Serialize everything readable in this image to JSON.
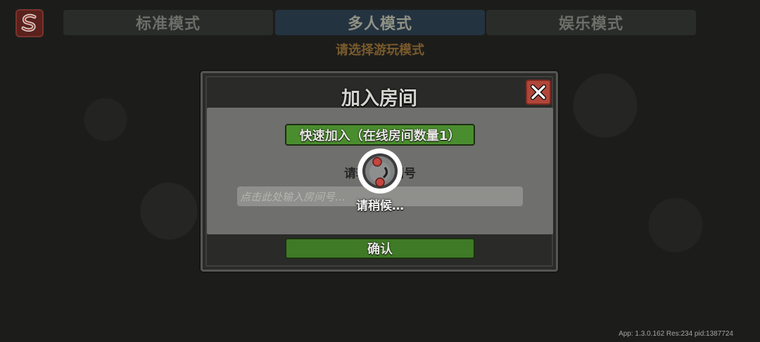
{
  "tabs": [
    {
      "label": "标准模式",
      "active": false
    },
    {
      "label": "多人模式",
      "active": true
    },
    {
      "label": "娱乐模式",
      "active": false
    }
  ],
  "subtitle": "请选择游玩模式",
  "dialog": {
    "title": "加入房间",
    "quick_join_label": "快速加入（在线房间数量1）",
    "room_label": "请输入房间号",
    "room_input_placeholder": "点击此处输入房间号…",
    "room_input_value": "",
    "confirm_label": "确认"
  },
  "loading": {
    "text": "请稍候…"
  },
  "footer": {
    "version_text": "App: 1.3.0.162 Res:234 pid:1387724"
  },
  "icons": {
    "logo": "s-logo-icon",
    "close": "close-icon",
    "spinner": "loading-spinner-icon"
  },
  "colors": {
    "accent_green": "#4a8d2e",
    "close_red": "#b0463a",
    "subtitle_gold": "#7a5a2c",
    "active_tab": "#243340"
  }
}
